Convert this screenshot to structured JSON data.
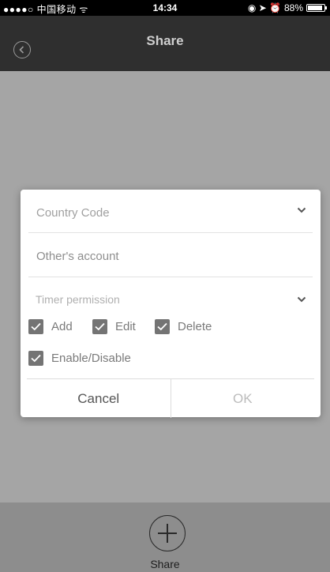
{
  "status_bar": {
    "carrier": "●●●●○ 中国移动 ᯤ",
    "time": "14:34",
    "icons": "◉ ➤ ⏰",
    "battery_text": "88%",
    "battery_level": 0.88
  },
  "header": {
    "title": "Share",
    "back_icon": "chevron-left-circle"
  },
  "dialog": {
    "country_code_placeholder": "Country Code",
    "account_placeholder": "Other's account",
    "timer_permission_label": "Timer permission",
    "permissions": [
      {
        "label": "Add",
        "checked": true
      },
      {
        "label": "Edit",
        "checked": true
      },
      {
        "label": "Delete",
        "checked": true
      },
      {
        "label": "Enable/Disable",
        "checked": true
      }
    ],
    "cancel_label": "Cancel",
    "ok_label": "OK"
  },
  "bottom": {
    "share_label": "Share",
    "add_icon": "plus-circle"
  }
}
